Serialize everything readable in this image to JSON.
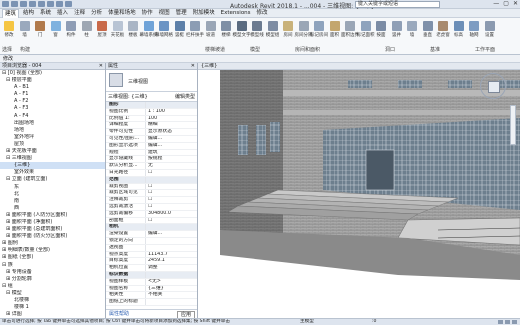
{
  "title_bar": {
    "app_title": "Autodesk Revit 2018.1 - ...004 - 三维视图: {三维}",
    "search_placeholder": "键入关键字或短语",
    "controls": [
      "—",
      "▢",
      "✕"
    ]
  },
  "ribbon_tabs": [
    "建筑",
    "结构",
    "系统",
    "插入",
    "注释",
    "分析",
    "体量和场地",
    "协作",
    "视图",
    "管理",
    "附加模块",
    "Extensions",
    "修改"
  ],
  "active_tab": "建筑",
  "ribbon_buttons": [
    {
      "label": "修改",
      "color": "#f5c542"
    },
    {
      "label": "墙",
      "color": "#9aa9bd"
    },
    {
      "label": "门",
      "color": "#b07a4c"
    },
    {
      "label": "窗",
      "color": "#7fb2df"
    },
    {
      "label": "构件",
      "color": "#8e9db5"
    },
    {
      "label": "柱",
      "color": "#9ea7b3"
    },
    {
      "label": "屋顶",
      "color": "#c96a4a"
    },
    {
      "label": "天花板",
      "color": "#b8c4d4"
    },
    {
      "label": "楼板",
      "color": "#a9b5c5"
    },
    {
      "label": "幕墙系统",
      "color": "#6fa3d8"
    },
    {
      "label": "幕墙网格",
      "color": "#6b94c4"
    },
    {
      "label": "竖梃",
      "color": "#5c7fa8"
    },
    {
      "label": "栏杆扶手",
      "color": "#8c9db4"
    },
    {
      "label": "坡道",
      "color": "#9aa6b6"
    },
    {
      "label": "楼梯",
      "color": "#7f8fa5"
    },
    {
      "label": "模型文字",
      "color": "#5a6b80"
    },
    {
      "label": "模型线",
      "color": "#6b7b90"
    },
    {
      "label": "模型组",
      "color": "#7d8ca3"
    },
    {
      "label": "房间",
      "color": "#c9b27a"
    },
    {
      "label": "房间分隔",
      "color": "#9aa6b6"
    },
    {
      "label": "标记房间",
      "color": "#8ea3bd"
    },
    {
      "label": "面积",
      "color": "#c3a66e"
    },
    {
      "label": "面积边界",
      "color": "#9aa6b6"
    },
    {
      "label": "标记面积",
      "color": "#8ea3bd"
    },
    {
      "label": "按面",
      "color": "#7b8ca5"
    },
    {
      "label": "竖井",
      "color": "#8f9fb6"
    },
    {
      "label": "墙",
      "color": "#9aa9bd"
    },
    {
      "label": "垂直",
      "color": "#7f91aa"
    },
    {
      "label": "老虎窗",
      "color": "#a88a6e"
    },
    {
      "label": "标高",
      "color": "#6c8fb8"
    },
    {
      "label": "轴网",
      "color": "#7d9cc2"
    },
    {
      "label": "设置",
      "color": "#8b9ab0"
    }
  ],
  "ribbon_panels": [
    "选择",
    "构建",
    "楼梯坡道",
    "模型",
    "房间和面积",
    "洞口",
    "基准",
    "工作平面"
  ],
  "option_bar": "修改",
  "project_browser": {
    "title": "项目浏览器 - 004",
    "rows": [
      {
        "text": "⊟ [0] 视图 (全部)",
        "indent": 0,
        "selected": false
      },
      {
        "text": "⊟ 楼层平面",
        "indent": 1,
        "selected": false
      },
      {
        "text": "A - B1",
        "indent": 3,
        "selected": false
      },
      {
        "text": "A - F1",
        "indent": 3,
        "selected": false
      },
      {
        "text": "A - F2",
        "indent": 3,
        "selected": false
      },
      {
        "text": "A - F3",
        "indent": 3,
        "selected": false
      },
      {
        "text": "A - F4",
        "indent": 3,
        "selected": false
      },
      {
        "text": "出图场地",
        "indent": 3,
        "selected": false
      },
      {
        "text": "场地",
        "indent": 3,
        "selected": false
      },
      {
        "text": "室外地坪",
        "indent": 3,
        "selected": false
      },
      {
        "text": "屋顶",
        "indent": 3,
        "selected": false
      },
      {
        "text": "⊞ 天花板平面",
        "indent": 1,
        "selected": false
      },
      {
        "text": "⊟ 三维视图",
        "indent": 1,
        "selected": false
      },
      {
        "text": "{三维}",
        "indent": 3,
        "selected": true
      },
      {
        "text": "室外效果",
        "indent": 3,
        "selected": false
      },
      {
        "text": "⊟ 立面 (建筑立面)",
        "indent": 1,
        "selected": false
      },
      {
        "text": "东",
        "indent": 3,
        "selected": false
      },
      {
        "text": "北",
        "indent": 3,
        "selected": false
      },
      {
        "text": "南",
        "indent": 3,
        "selected": false
      },
      {
        "text": "西",
        "indent": 3,
        "selected": false
      },
      {
        "text": "⊞ 面积平面 (人防分区面积)",
        "indent": 1,
        "selected": false
      },
      {
        "text": "⊞ 面积平面 (净面积)",
        "indent": 1,
        "selected": false
      },
      {
        "text": "⊞ 面积平面 (总建筑面积)",
        "indent": 1,
        "selected": false
      },
      {
        "text": "⊞ 面积平面 (防火分区面积)",
        "indent": 1,
        "selected": false
      },
      {
        "text": "⊞ 图例",
        "indent": 0,
        "selected": false
      },
      {
        "text": "⊞ 明细表/数量 (全部)",
        "indent": 0,
        "selected": false
      },
      {
        "text": "⊞ 图纸 (全部)",
        "indent": 0,
        "selected": false
      },
      {
        "text": "⊟ 族",
        "indent": 0,
        "selected": false
      },
      {
        "text": "⊞ 专用设备",
        "indent": 1,
        "selected": false
      },
      {
        "text": "⊞ 分割轮廓",
        "indent": 1,
        "selected": false
      },
      {
        "text": "⊟ 组",
        "indent": 0,
        "selected": false
      },
      {
        "text": "⊟ 模型",
        "indent": 1,
        "selected": false
      },
      {
        "text": "北楼梯",
        "indent": 3,
        "selected": false
      },
      {
        "text": "楼梯 1",
        "indent": 3,
        "selected": false
      },
      {
        "text": "⊞ 详图",
        "indent": 1,
        "selected": false
      },
      {
        "text": "⊞ Revit 链接",
        "indent": 0,
        "selected": false
      }
    ]
  },
  "properties": {
    "title": "属性",
    "type_name": "三维视图",
    "type_dropdown": "三维视图: {三维}",
    "edit_type": "编辑类型",
    "rows": [
      {
        "k": "图形",
        "v": "",
        "group": true
      },
      {
        "k": "视图比例",
        "v": "1 : 100"
      },
      {
        "k": "比例值 1:",
        "v": "100"
      },
      {
        "k": "详细程度",
        "v": "精细"
      },
      {
        "k": "零件可见性",
        "v": "显示原状态"
      },
      {
        "k": "可见性/图形...",
        "v": "编辑..."
      },
      {
        "k": "图形显示选项",
        "v": "编辑..."
      },
      {
        "k": "规程",
        "v": "建筑"
      },
      {
        "k": "显示隐藏线",
        "v": "按规程"
      },
      {
        "k": "默认分析显...",
        "v": "无"
      },
      {
        "k": "日光路径",
        "v": "☐"
      },
      {
        "k": "范围",
        "v": "",
        "group": true
      },
      {
        "k": "裁剪视图",
        "v": "☐"
      },
      {
        "k": "裁剪区域可见",
        "v": "☐"
      },
      {
        "k": "注释裁剪",
        "v": "☐"
      },
      {
        "k": "远剪裁激活",
        "v": "☐"
      },
      {
        "k": "远剪裁偏移",
        "v": "304800.0"
      },
      {
        "k": "剖面框",
        "v": "☐"
      },
      {
        "k": "相机",
        "v": "",
        "group": true
      },
      {
        "k": "渲染设置",
        "v": "编辑..."
      },
      {
        "k": "锁定的方向",
        "v": ""
      },
      {
        "k": "透视图",
        "v": ""
      },
      {
        "k": "视点高度",
        "v": "11143.7"
      },
      {
        "k": "目标高度",
        "v": "2459.1"
      },
      {
        "k": "相机位置",
        "v": "调整"
      },
      {
        "k": "标识数据",
        "v": "",
        "group": true
      },
      {
        "k": "视图样板",
        "v": "<无>"
      },
      {
        "k": "视图名称",
        "v": "{三维}"
      },
      {
        "k": "相关性",
        "v": "不相关"
      },
      {
        "k": "图纸上的标题",
        "v": ""
      }
    ],
    "help_link": "属性帮助",
    "apply": "应用"
  },
  "view": {
    "tab_title": "{三维}",
    "cube_label": "前"
  },
  "status_bar": {
    "hint": "单击可进行选择; 按 Tab 键并单击可选择其他项目; 按 Ctrl 键并单击可将新项目添加到选择集; 按 Shift 键并单击",
    "model": "主模型",
    "zero": ":0"
  },
  "colors": {
    "ribbon_bg": "#f6f8fa",
    "panel_header": "#dfe5ee",
    "selected_row": "#cfe0f5",
    "building_wall": "#8d8d8d",
    "glass": "#6d7f8e"
  }
}
